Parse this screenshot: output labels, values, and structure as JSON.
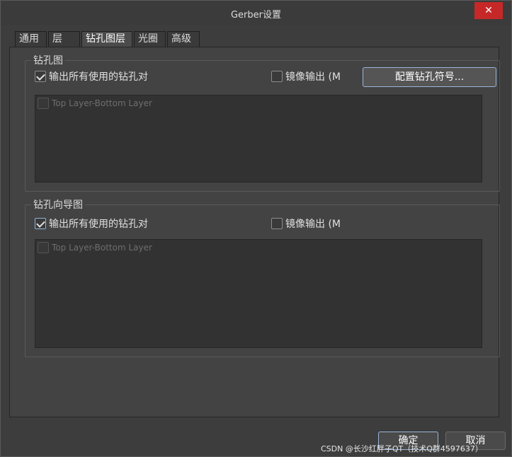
{
  "window": {
    "title": "Gerber设置",
    "close_glyph": "✕",
    "close_color": "#c62828"
  },
  "tabs": [
    {
      "label": "通用",
      "active": false
    },
    {
      "label": "层",
      "active": false
    },
    {
      "label": "钻孔图层",
      "active": true
    },
    {
      "label": "光圈",
      "active": false
    },
    {
      "label": "高级",
      "active": false
    }
  ],
  "drill_drawing": {
    "legend": "钻孔图",
    "output_all_pairs": {
      "label": "输出所有使用的钻孔对",
      "checked": true
    },
    "mirror_output": {
      "label": "镜像输出 (M",
      "checked": false
    },
    "config_button": "配置钻孔符号...",
    "list": [
      {
        "label": "Top Layer-Bottom Layer",
        "checked": false
      }
    ]
  },
  "drill_guide": {
    "legend": "钻孔向导图",
    "output_all_pairs": {
      "label": "输出所有使用的钻孔对",
      "checked": true
    },
    "mirror_output": {
      "label": "镜像输出 (M",
      "checked": false
    },
    "list": [
      {
        "label": "Top Layer-Bottom Layer",
        "checked": false
      }
    ]
  },
  "footer": {
    "ok": "确定",
    "cancel": "取消",
    "watermark": "CSDN @长沙红胖子QT（技术Q群4597637）"
  },
  "colors": {
    "background": "#3c3c3c",
    "panel": "#434343",
    "accent_border": "#9ab6d8"
  }
}
